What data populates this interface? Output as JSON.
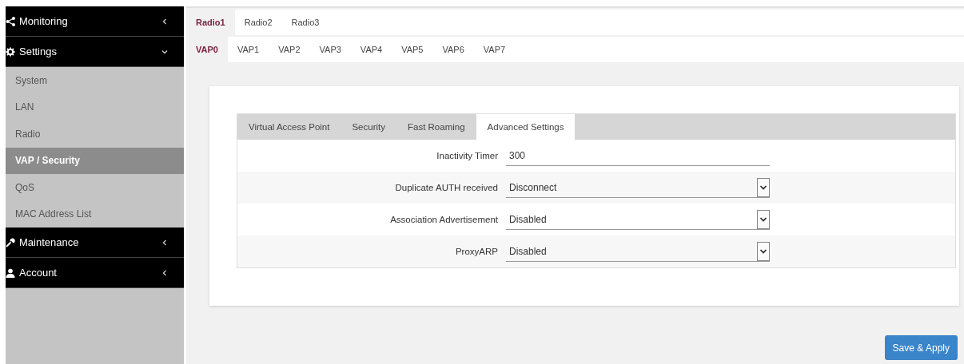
{
  "sidebar": {
    "items": [
      {
        "kind": "header",
        "label": "Monitoring",
        "expanded": false
      },
      {
        "kind": "header",
        "label": "Settings",
        "expanded": true,
        "children": [
          {
            "label": "System",
            "selected": false
          },
          {
            "label": "LAN",
            "selected": false
          },
          {
            "label": "Radio",
            "selected": false
          },
          {
            "label": "VAP / Security",
            "selected": true
          },
          {
            "label": "QoS",
            "selected": false
          },
          {
            "label": "MAC Address List",
            "selected": false
          }
        ]
      },
      {
        "kind": "header",
        "label": "Maintenance",
        "expanded": false
      },
      {
        "kind": "header",
        "label": "Account",
        "expanded": false
      }
    ]
  },
  "radio_tabs": [
    {
      "label": "Radio1",
      "selected": true
    },
    {
      "label": "Radio2",
      "selected": false
    },
    {
      "label": "Radio3",
      "selected": false
    }
  ],
  "vap_tabs": [
    {
      "label": "VAP0",
      "selected": true
    },
    {
      "label": "VAP1",
      "selected": false
    },
    {
      "label": "VAP2",
      "selected": false
    },
    {
      "label": "VAP3",
      "selected": false
    },
    {
      "label": "VAP4",
      "selected": false
    },
    {
      "label": "VAP5",
      "selected": false
    },
    {
      "label": "VAP6",
      "selected": false
    },
    {
      "label": "VAP7",
      "selected": false
    }
  ],
  "section_tabs": [
    {
      "label": "Virtual Access Point",
      "selected": false
    },
    {
      "label": "Security",
      "selected": false
    },
    {
      "label": "Fast Roaming",
      "selected": false
    },
    {
      "label": "Advanced Settings",
      "selected": true
    }
  ],
  "form": [
    {
      "kind": "text",
      "label": "Inactivity Timer",
      "value": "300"
    },
    {
      "kind": "select",
      "label": "Duplicate AUTH received",
      "value": "Disconnect"
    },
    {
      "kind": "select",
      "label": "Association Advertisement",
      "value": "Disabled"
    },
    {
      "kind": "select",
      "label": "ProxyARP",
      "value": "Disabled"
    }
  ],
  "save_button": "Save & Apply"
}
